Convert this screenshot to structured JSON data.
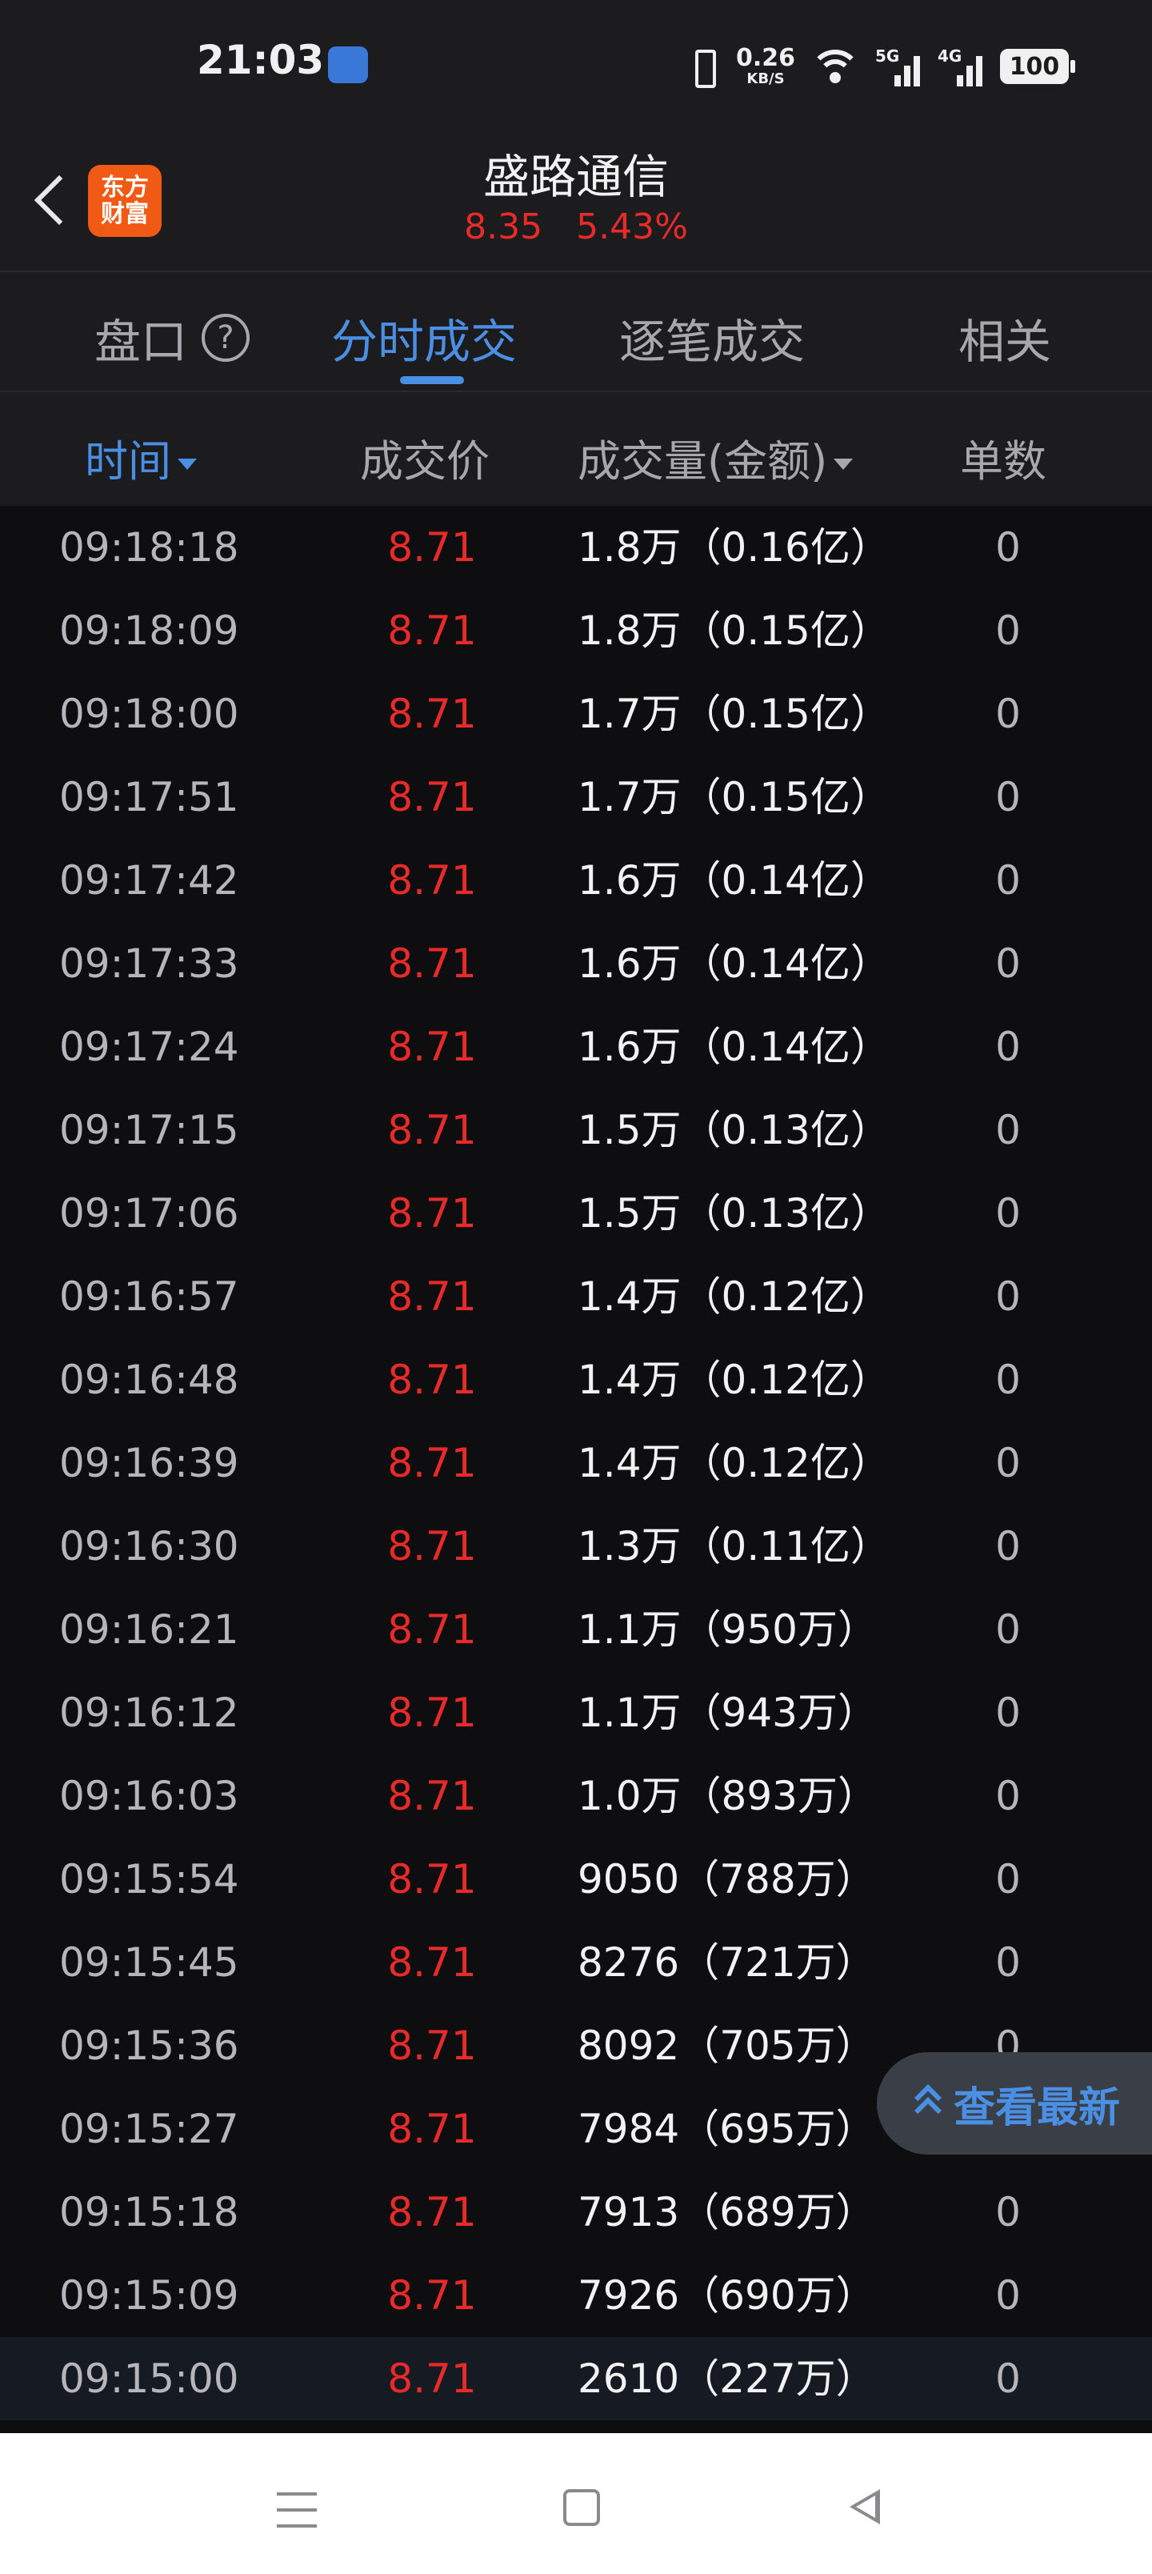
{
  "status_bar": {
    "time": "21:03",
    "net_speed_value": "0.26",
    "net_speed_unit": "KB/S",
    "signal1_label": "5G",
    "signal2_label": "4G",
    "battery": "100"
  },
  "header": {
    "logo_line1": "东方",
    "logo_line2": "财富",
    "stock_name": "盛路通信",
    "price": "8.35",
    "change_pct": "5.43%"
  },
  "tabs": [
    {
      "label": "盘口",
      "active": false
    },
    {
      "label": "分时成交",
      "active": true
    },
    {
      "label": "逐笔成交",
      "active": false
    },
    {
      "label": "相关",
      "active": false
    }
  ],
  "columns": {
    "time": "时间",
    "price": "成交价",
    "volume": "成交量(金额)",
    "count": "单数"
  },
  "rows": [
    {
      "time": "09:18:18",
      "price": "8.71",
      "volume": "1.8万（0.16亿）",
      "count": "0"
    },
    {
      "time": "09:18:09",
      "price": "8.71",
      "volume": "1.8万（0.15亿）",
      "count": "0"
    },
    {
      "time": "09:18:00",
      "price": "8.71",
      "volume": "1.7万（0.15亿）",
      "count": "0"
    },
    {
      "time": "09:17:51",
      "price": "8.71",
      "volume": "1.7万（0.15亿）",
      "count": "0"
    },
    {
      "time": "09:17:42",
      "price": "8.71",
      "volume": "1.6万（0.14亿）",
      "count": "0"
    },
    {
      "time": "09:17:33",
      "price": "8.71",
      "volume": "1.6万（0.14亿）",
      "count": "0"
    },
    {
      "time": "09:17:24",
      "price": "8.71",
      "volume": "1.6万（0.14亿）",
      "count": "0"
    },
    {
      "time": "09:17:15",
      "price": "8.71",
      "volume": "1.5万（0.13亿）",
      "count": "0"
    },
    {
      "time": "09:17:06",
      "price": "8.71",
      "volume": "1.5万（0.13亿）",
      "count": "0"
    },
    {
      "time": "09:16:57",
      "price": "8.71",
      "volume": "1.4万（0.12亿）",
      "count": "0"
    },
    {
      "time": "09:16:48",
      "price": "8.71",
      "volume": "1.4万（0.12亿）",
      "count": "0"
    },
    {
      "time": "09:16:39",
      "price": "8.71",
      "volume": "1.4万（0.12亿）",
      "count": "0"
    },
    {
      "time": "09:16:30",
      "price": "8.71",
      "volume": "1.3万（0.11亿）",
      "count": "0"
    },
    {
      "time": "09:16:21",
      "price": "8.71",
      "volume": "1.1万（950万）",
      "count": "0"
    },
    {
      "time": "09:16:12",
      "price": "8.71",
      "volume": "1.1万（943万）",
      "count": "0"
    },
    {
      "time": "09:16:03",
      "price": "8.71",
      "volume": "1.0万（893万）",
      "count": "0"
    },
    {
      "time": "09:15:54",
      "price": "8.71",
      "volume": "9050（788万）",
      "count": "0"
    },
    {
      "time": "09:15:45",
      "price": "8.71",
      "volume": "8276（721万）",
      "count": "0"
    },
    {
      "time": "09:15:36",
      "price": "8.71",
      "volume": "8092（705万）",
      "count": "0"
    },
    {
      "time": "09:15:27",
      "price": "8.71",
      "volume": "7984（695万）",
      "count": ""
    },
    {
      "time": "09:15:18",
      "price": "8.71",
      "volume": "7913（689万）",
      "count": "0"
    },
    {
      "time": "09:15:09",
      "price": "8.71",
      "volume": "7926（690万）",
      "count": "0"
    },
    {
      "time": "09:15:00",
      "price": "8.71",
      "volume": "2610（227万）",
      "count": "0"
    }
  ],
  "latest_button": {
    "label": "查看最新"
  },
  "colors": {
    "up_red": "#e82a2a",
    "accent_blue": "#4a8fe4",
    "background": "#0e0e10",
    "panel": "#1c1c1e",
    "logo_orange": "#f05a14"
  }
}
